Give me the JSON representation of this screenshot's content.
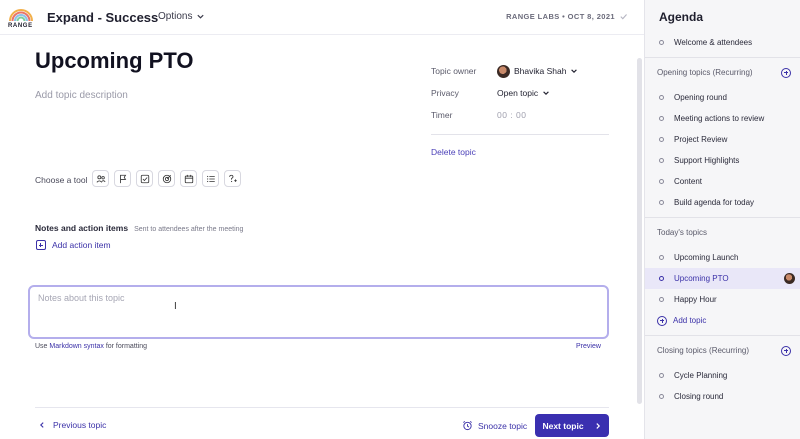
{
  "app": {
    "logo_text": "RANGE",
    "meeting_title": "Expand - Success",
    "options_label": "Options",
    "meta": "RANGE LABS • OCT 8, 2021"
  },
  "topic": {
    "title": "Upcoming PTO",
    "description_placeholder": "Add topic description",
    "owner_label": "Topic owner",
    "owner_name": "Bhavika Shah",
    "privacy_label": "Privacy",
    "privacy_value": "Open topic",
    "timer_label": "Timer",
    "timer_value": "00 : 00",
    "delete_label": "Delete topic"
  },
  "tools": {
    "label": "Choose a tool",
    "items": [
      "people-icon",
      "flag-icon",
      "checkbox-icon",
      "target-icon",
      "calendar-icon",
      "list-icon",
      "question-icon"
    ]
  },
  "notes": {
    "heading": "Notes and action items",
    "subheading": "Sent to attendees after the meeting",
    "add_action_label": "Add action item",
    "placeholder": "Notes about this topic",
    "hint_prefix": "Use ",
    "hint_link": "Markdown syntax",
    "hint_suffix": " for formatting",
    "preview_label": "Preview"
  },
  "footer": {
    "previous_label": "Previous topic",
    "snooze_label": "Snooze topic",
    "next_label": "Next topic"
  },
  "sidebar": {
    "title": "Agenda",
    "top_items": [
      "Welcome & attendees"
    ],
    "sections": [
      {
        "title": "Opening topics (Recurring)",
        "items": [
          "Opening round",
          "Meeting actions to review",
          "Project Review",
          "Support Highlights",
          "Content",
          "Build agenda for today"
        ]
      },
      {
        "title": "Today's topics",
        "items": [
          "Upcoming Launch",
          "Upcoming PTO",
          "Happy Hour"
        ],
        "add_label": "Add topic"
      },
      {
        "title": "Closing topics (Recurring)",
        "items": [
          "Cycle Planning",
          "Closing round"
        ]
      }
    ]
  },
  "colors": {
    "accent": "#3a2fb0",
    "focus_border": "#b4aeec",
    "active_item_bg": "#e9e7f8"
  }
}
